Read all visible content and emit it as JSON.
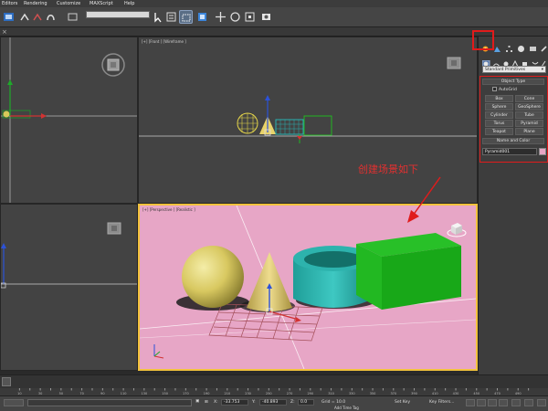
{
  "menu": [
    "Editors",
    "Rendering",
    "Customize",
    "MAXScript",
    "Help"
  ],
  "toolbar": {
    "selection_filter": "",
    "icons": [
      "undo-icon",
      "redo-icon",
      "select-link-icon",
      "unlink-icon",
      "bind-icon",
      "select-icon",
      "select-by-name-icon",
      "region-select-icon",
      "window-crossing-icon",
      "move-icon",
      "rotate-icon",
      "scale-icon",
      "ref-coord-icon",
      "pivot-icon",
      "select-manipulate-icon",
      "snap-icon",
      "angle-snap-icon",
      "percent-snap-icon",
      "spinner-snap-icon",
      "edit-named-sets-icon",
      "mirror-icon",
      "align-icon",
      "layers-icon",
      "curve-editor-icon",
      "schematic-icon",
      "material-editor-icon",
      "render-setup-icon",
      "rendered-frame-icon",
      "render-icon"
    ]
  },
  "viewports": {
    "front": {
      "label": "[+] [Front ] [Wireframe ]"
    },
    "perspective": {
      "label": "[+] [Perspective ] [Realistic ]"
    }
  },
  "command_panel": {
    "category": "Standard Primitives",
    "object_type_title": "Object Type",
    "autogrid_label": "AutoGrid",
    "primitives": [
      "Box",
      "Cone",
      "Sphere",
      "GeoSphere",
      "Cylinder",
      "Tube",
      "Torus",
      "Pyramid",
      "Teapot",
      "Plane"
    ],
    "name_color_title": "Name and Color",
    "name_value": "Pyramid001",
    "object_color": "#e7a6c6"
  },
  "annotation": "创建场景如下",
  "status": {
    "x_label": "X:",
    "x_value": "-33.753",
    "y_label": "Y:",
    "y_value": "-40.893",
    "z_label": "Z:",
    "z_value": "0.0",
    "grid": "Grid = 10.0",
    "add_time_tag": "Add Time Tag",
    "set_key": "Set Key",
    "key_filters": "Key Filters..."
  },
  "ruler_ticks": [
    "10",
    "20",
    "30",
    "40",
    "50",
    "60",
    "70",
    "80",
    "90",
    "100",
    "110",
    "120",
    "130",
    "140",
    "150",
    "160",
    "170",
    "180",
    "190",
    "200",
    "210",
    "220",
    "230",
    "240",
    "250",
    "260",
    "270",
    "280",
    "290",
    "300",
    "310",
    "320",
    "330",
    "340",
    "350",
    "360",
    "370",
    "380",
    "390",
    "400",
    "410",
    "420",
    "430",
    "440",
    "450",
    "460",
    "470",
    "480",
    "490",
    "500"
  ],
  "colors": {
    "accent": "#e01b1b",
    "viewport_bg": "#434343",
    "perspective_bg": "#e7a6c6"
  }
}
